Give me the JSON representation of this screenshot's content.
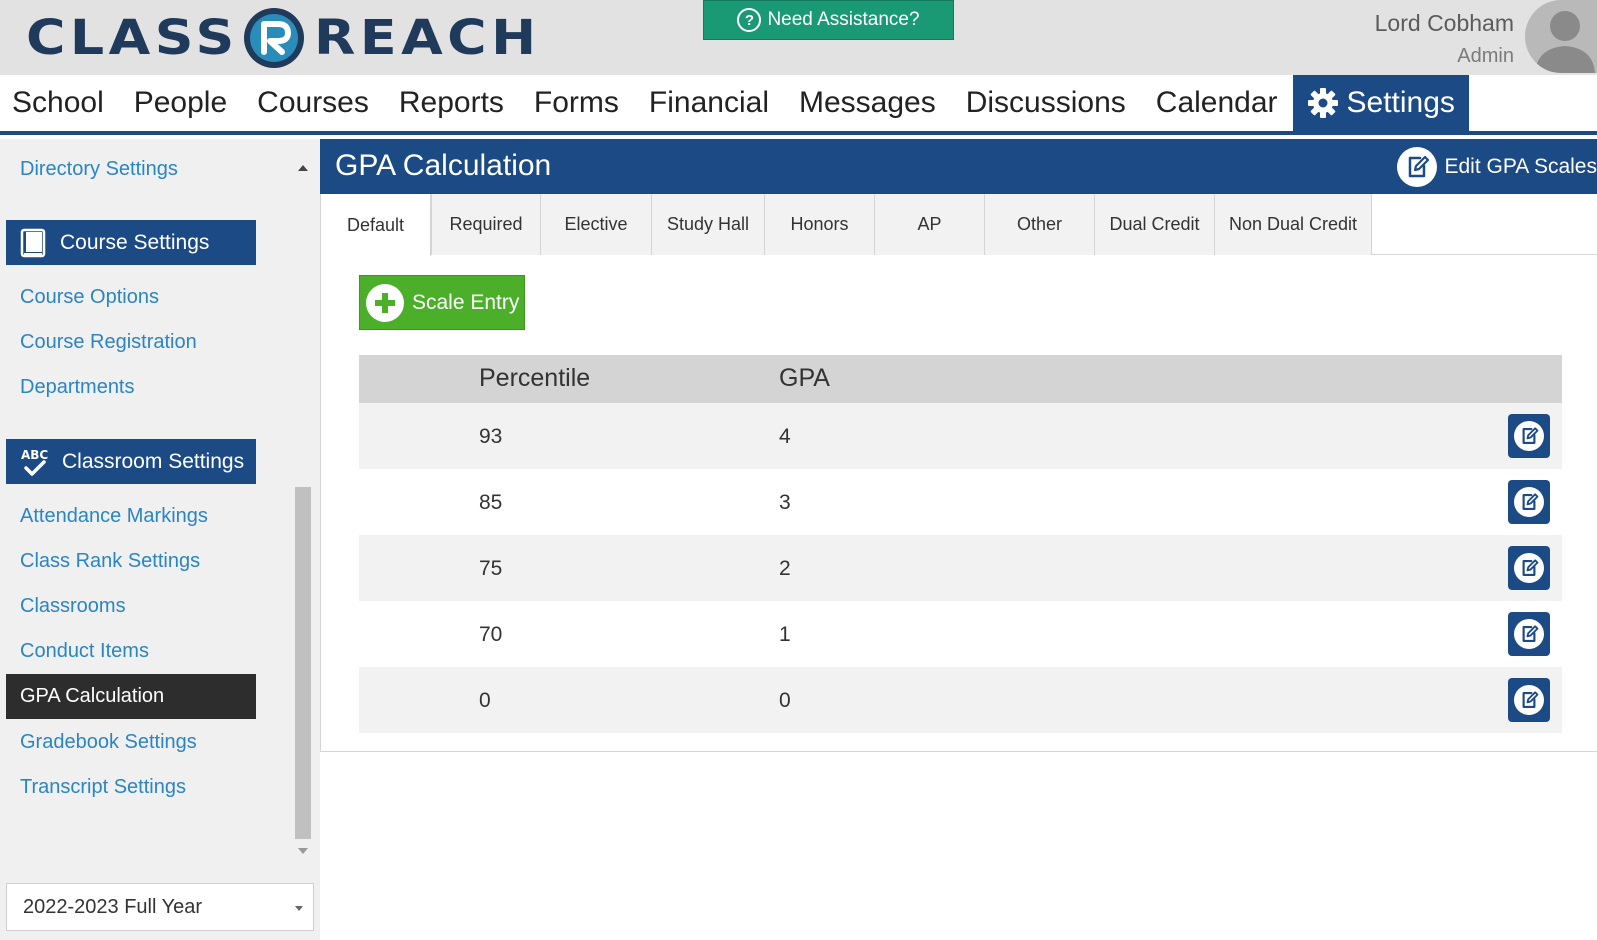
{
  "header": {
    "logo_left": "CLASS",
    "logo_right": "REACH",
    "assistance_label": "Need Assistance?",
    "user_name": "Lord Cobham",
    "user_role": "Admin"
  },
  "nav": {
    "items": [
      "School",
      "People",
      "Courses",
      "Reports",
      "Forms",
      "Financial",
      "Messages",
      "Discussions",
      "Calendar",
      "Settings"
    ],
    "active": "Settings"
  },
  "sidebar": {
    "directory_settings": "Directory Settings",
    "course_settings_header": "Course Settings",
    "course_links": [
      "Course Options",
      "Course Registration",
      "Departments"
    ],
    "classroom_settings_header": "Classroom Settings",
    "classroom_links": [
      "Attendance Markings",
      "Class Rank Settings",
      "Classrooms",
      "Conduct Items"
    ],
    "active_link": "GPA Calculation",
    "after_links": [
      "Gradebook Settings",
      "Transcript Settings"
    ],
    "year_select": "2022-2023 Full Year"
  },
  "main": {
    "title": "GPA Calculation",
    "edit_scales_label": "Edit GPA Scales",
    "tabs": [
      "Default",
      "Required",
      "Elective",
      "Study Hall",
      "Honors",
      "AP",
      "Other",
      "Dual Credit",
      "Non Dual Credit"
    ],
    "active_tab": "Default",
    "scale_entry_label": "Scale Entry",
    "table": {
      "headers": [
        "Percentile",
        "GPA"
      ],
      "rows": [
        {
          "percentile": "93",
          "gpa": "4"
        },
        {
          "percentile": "85",
          "gpa": "3"
        },
        {
          "percentile": "75",
          "gpa": "2"
        },
        {
          "percentile": "70",
          "gpa": "1"
        },
        {
          "percentile": "0",
          "gpa": "0"
        }
      ]
    }
  },
  "colors": {
    "brand_blue": "#1c4a85",
    "assist_green": "#1a9a74",
    "add_green": "#4caf2a",
    "link_blue": "#2a85c3"
  }
}
